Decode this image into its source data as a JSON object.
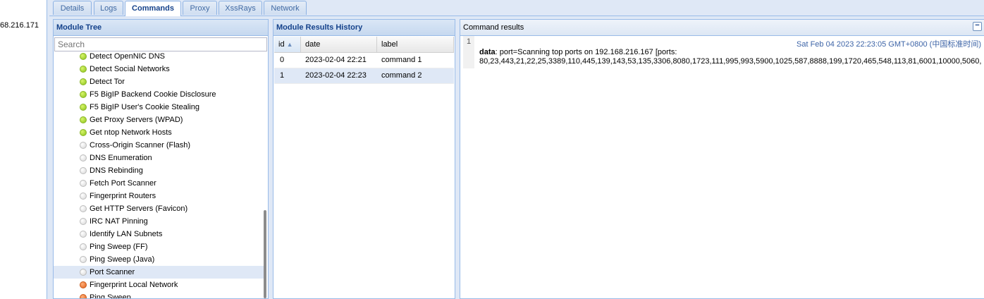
{
  "left_panel": {
    "ip_fragment": "68.216.171"
  },
  "tabs": [
    {
      "label": "Details",
      "active": false
    },
    {
      "label": "Logs",
      "active": false
    },
    {
      "label": "Commands",
      "active": true
    },
    {
      "label": "Proxy",
      "active": false
    },
    {
      "label": "XssRays",
      "active": false
    },
    {
      "label": "Network",
      "active": false
    }
  ],
  "module_tree": {
    "title": "Module Tree",
    "search_placeholder": "Search",
    "items": [
      {
        "label": "Detect OpenNIC DNS",
        "status": "green"
      },
      {
        "label": "Detect Social Networks",
        "status": "green"
      },
      {
        "label": "Detect Tor",
        "status": "green"
      },
      {
        "label": "F5 BigIP Backend Cookie Disclosure",
        "status": "green"
      },
      {
        "label": "F5 BigIP User's Cookie Stealing",
        "status": "green"
      },
      {
        "label": "Get Proxy Servers (WPAD)",
        "status": "green"
      },
      {
        "label": "Get ntop Network Hosts",
        "status": "green"
      },
      {
        "label": "Cross-Origin Scanner (Flash)",
        "status": "grey"
      },
      {
        "label": "DNS Enumeration",
        "status": "grey"
      },
      {
        "label": "DNS Rebinding",
        "status": "grey"
      },
      {
        "label": "Fetch Port Scanner",
        "status": "grey"
      },
      {
        "label": "Fingerprint Routers",
        "status": "grey"
      },
      {
        "label": "Get HTTP Servers (Favicon)",
        "status": "grey"
      },
      {
        "label": "IRC NAT Pinning",
        "status": "grey"
      },
      {
        "label": "Identify LAN Subnets",
        "status": "grey"
      },
      {
        "label": "Ping Sweep (FF)",
        "status": "grey"
      },
      {
        "label": "Ping Sweep (Java)",
        "status": "grey"
      },
      {
        "label": "Port Scanner",
        "status": "grey",
        "selected": true
      },
      {
        "label": "Fingerprint Local Network",
        "status": "orange"
      },
      {
        "label": "Ping Sweep",
        "status": "orange"
      }
    ]
  },
  "results_history": {
    "title": "Module Results History",
    "columns": [
      "id",
      "date",
      "label"
    ],
    "rows": [
      {
        "id": "0",
        "date": "2023-02-04 22:21",
        "label": "command 1"
      },
      {
        "id": "1",
        "date": "2023-02-04 22:23",
        "label": "command 2",
        "selected": true
      }
    ]
  },
  "command_results": {
    "title": "Command results",
    "collapse_glyph": "−",
    "entry_number": "1",
    "timestamp": "Sat Feb 04 2023 22:23:05 GMT+0800 (中国标准时间)",
    "data_key": "data",
    "data_line1": ": port=Scanning top ports on 192.168.216.167 [ports:",
    "data_line2": "80,23,443,21,22,25,3389,110,445,139,143,53,135,3306,8080,1723,111,995,993,5900,1025,587,8888,199,1720,465,548,113,81,6001,10000,5060,"
  },
  "colors": {
    "accent": "#15428b",
    "panel_border": "#99bbe8",
    "selected_row": "#dfe8f6",
    "status_green": "#8ac21a",
    "status_grey": "#d6d6d6",
    "status_orange": "#e2601c"
  }
}
